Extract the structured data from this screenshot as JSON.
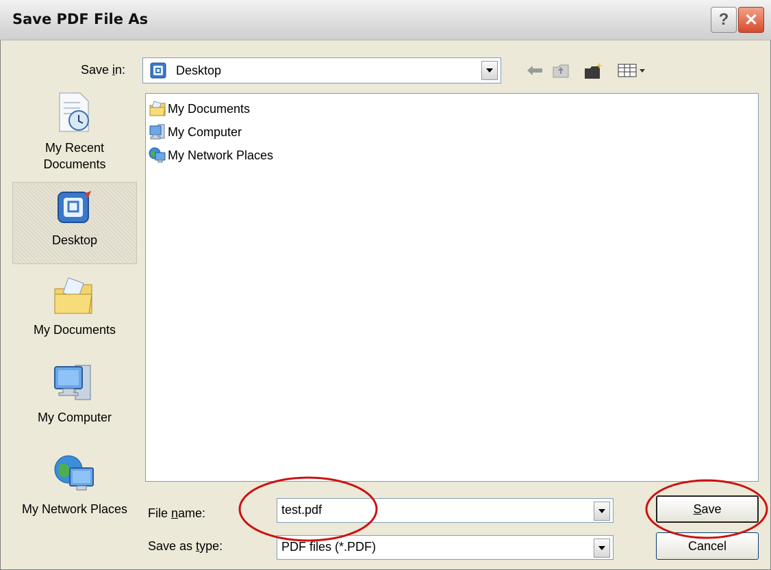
{
  "window": {
    "title": "Save PDF File As",
    "help_glyph": "?",
    "close_glyph": "✕"
  },
  "toolbar": {
    "save_in_label_pre": "Save ",
    "save_in_label_u": "i",
    "save_in_label_post": "n:",
    "save_in_value": "Desktop",
    "icons": [
      "back-icon",
      "up-folder-icon",
      "new-folder-icon",
      "view-menu-icon"
    ]
  },
  "places": [
    {
      "label": "My Recent Documents",
      "icon": "recent-documents-icon"
    },
    {
      "label": "Desktop",
      "icon": "desktop-icon",
      "selected": true
    },
    {
      "label": "My Documents",
      "icon": "my-documents-icon"
    },
    {
      "label": "My Computer",
      "icon": "my-computer-icon"
    },
    {
      "label": "My Network Places",
      "icon": "network-places-icon"
    }
  ],
  "files": [
    {
      "name": "My Documents",
      "icon": "folder-icon"
    },
    {
      "name": "My Computer",
      "icon": "computer-icon"
    },
    {
      "name": "My Network Places",
      "icon": "network-icon"
    }
  ],
  "form": {
    "file_name_label_pre": "File ",
    "file_name_label_u": "n",
    "file_name_label_post": "ame:",
    "file_name_value": "test.pdf",
    "save_type_label_pre": "Save as ",
    "save_type_label_u": "t",
    "save_type_label_post": "ype:",
    "save_type_value": "PDF files (*.PDF)"
  },
  "buttons": {
    "save_u": "S",
    "save_rest": "ave",
    "cancel": "Cancel"
  },
  "colors": {
    "dialog_bg": "#ece9d8",
    "annotation_red": "#cc1111",
    "field_border": "#7f9db9"
  }
}
